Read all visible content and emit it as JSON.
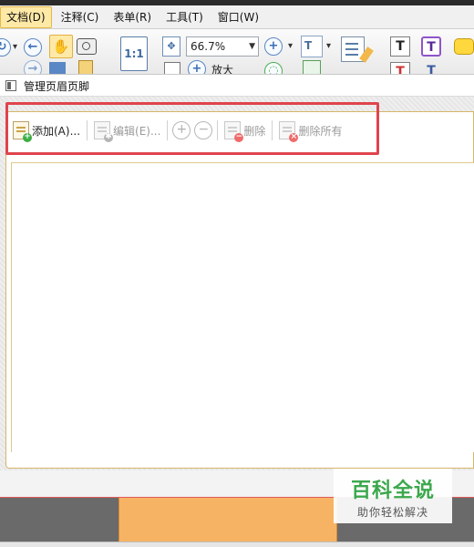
{
  "menu": {
    "items": [
      "文档(D)",
      "注释(C)",
      "表单(R)",
      "工具(T)",
      "窗口(W)"
    ],
    "active_index": 0
  },
  "toolbar": {
    "zoom_value": "66.7%",
    "page_label": "1:1",
    "partial_label": "放大"
  },
  "dialog": {
    "title": "管理页眉页脚",
    "actions": {
      "add": "添加(A)...",
      "edit": "编辑(E)...",
      "delete": "删除",
      "delete_all": "删除所有"
    }
  },
  "watermark": {
    "main": "百科全说",
    "sub": "助你轻松解决"
  },
  "colors": {
    "highlight": "#e0444c",
    "accent_yellow": "#ffe9a6",
    "watermark_green": "#3ba84c",
    "document_orange": "#f7b364"
  }
}
